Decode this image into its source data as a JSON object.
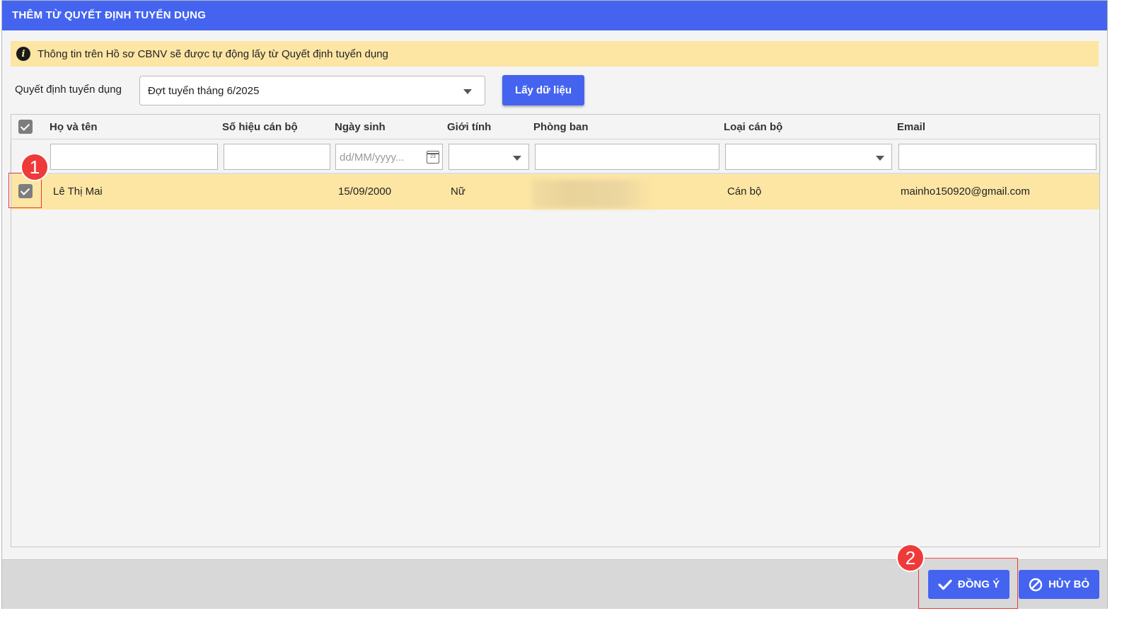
{
  "dialog": {
    "title": "THÊM TỪ QUYẾT ĐỊNH TUYỂN DỤNG",
    "info_icon": "info-icon",
    "info_text": "Thông tin trên Hồ sơ CBNV sẽ được tự động lấy từ Quyết định tuyển dụng"
  },
  "form": {
    "decision_label": "Quyết định tuyển dụng",
    "decision_value": "Đợt tuyển tháng 6/2025",
    "fetch_button": "Lấy dữ liệu"
  },
  "grid": {
    "columns": [
      "Họ và tên",
      "Số hiệu cán bộ",
      "Ngày sinh",
      "Giới tính",
      "Phòng ban",
      "Loại cán bộ",
      "Email"
    ],
    "date_placeholder": "dd/MM/yyyy...",
    "calendar_day": "23",
    "rows": [
      {
        "selected": true,
        "name": "Lê Thị Mai",
        "staff_id": "",
        "dob": "15/09/2000",
        "gender": "Nữ",
        "department": "",
        "staff_type": "Cán bộ",
        "email": "mainho150920@gmail.com"
      }
    ]
  },
  "footer": {
    "ok_button": "ĐỒNG Ý",
    "cancel_button": "HỦY BỎ"
  },
  "annotations": {
    "step1": "1",
    "step2": "2"
  },
  "colors": {
    "primary": "#4464f0",
    "highlight_row": "#fde6a4",
    "annotation": "#ef3a3a"
  }
}
